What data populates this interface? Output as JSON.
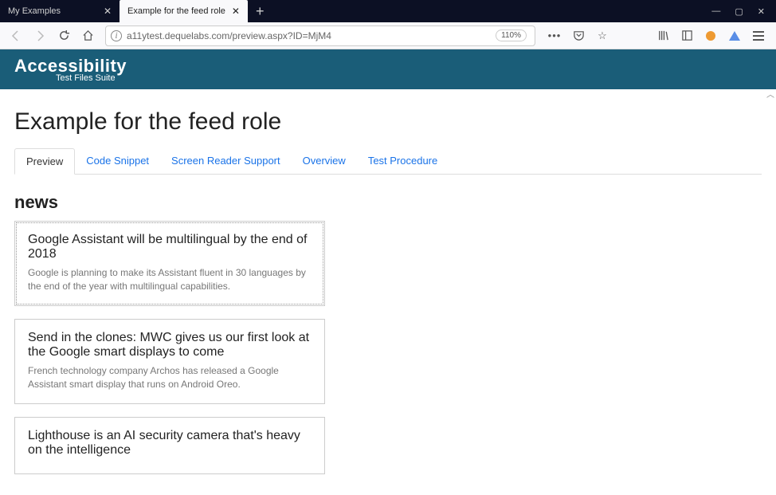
{
  "browser": {
    "tabs": [
      {
        "title": "My Examples",
        "active": false
      },
      {
        "title": "Example for the feed role",
        "active": true
      }
    ],
    "url": "a11ytest.dequelabs.com/preview.aspx?ID=MjM4",
    "zoom": "110%"
  },
  "header": {
    "logo_main": "Accessibility",
    "logo_sub": "Test Files Suite"
  },
  "page": {
    "title": "Example for the feed role",
    "tabs": [
      {
        "label": "Preview",
        "active": true
      },
      {
        "label": "Code Snippet",
        "active": false
      },
      {
        "label": "Screen Reader Support",
        "active": false
      },
      {
        "label": "Overview",
        "active": false
      },
      {
        "label": "Test Procedure",
        "active": false
      }
    ],
    "section_heading": "news",
    "articles": [
      {
        "title": "Google Assistant will be multilingual by the end of 2018",
        "body": "Google is planning to make its Assistant fluent in 30 languages by the end of the year with multilingual capabilities.",
        "focused": true
      },
      {
        "title": "Send in the clones: MWC gives us our first look at the Google smart displays to come",
        "body": "French technology company Archos has released a Google Assistant smart display that runs on Android Oreo.",
        "focused": false
      },
      {
        "title": "Lighthouse is an AI security camera that's heavy on the intelligence",
        "body": "",
        "focused": false
      }
    ]
  }
}
